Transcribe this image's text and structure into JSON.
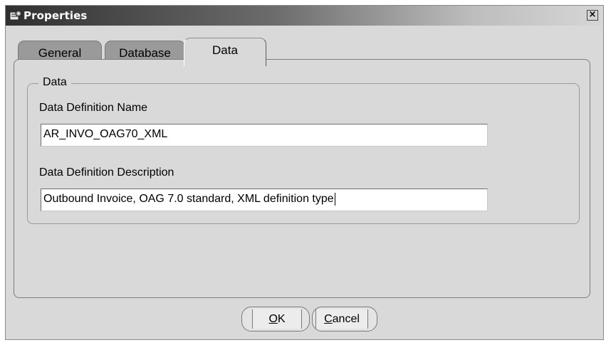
{
  "window": {
    "title": "Properties",
    "icon": "properties-icon",
    "close_label": "×"
  },
  "tabs": [
    {
      "label": "General",
      "active": false
    },
    {
      "label": "Database",
      "active": false
    },
    {
      "label": "Data",
      "active": true
    }
  ],
  "data_group": {
    "legend": "Data",
    "name_label": "Data Definition Name",
    "name_value": "AR_INVO_OAG70_XML",
    "description_label": "Data Definition Description",
    "description_value": "Outbound Invoice, OAG 7.0 standard, XML definition type"
  },
  "buttons": {
    "ok_mnemonic": "O",
    "ok_rest": "K",
    "cancel_mnemonic": "C",
    "cancel_rest": "ancel"
  },
  "colors": {
    "window_bg": "#d9d9d9",
    "tab_inactive": "#9a9a9a",
    "titlebar_dark": "#303030"
  }
}
